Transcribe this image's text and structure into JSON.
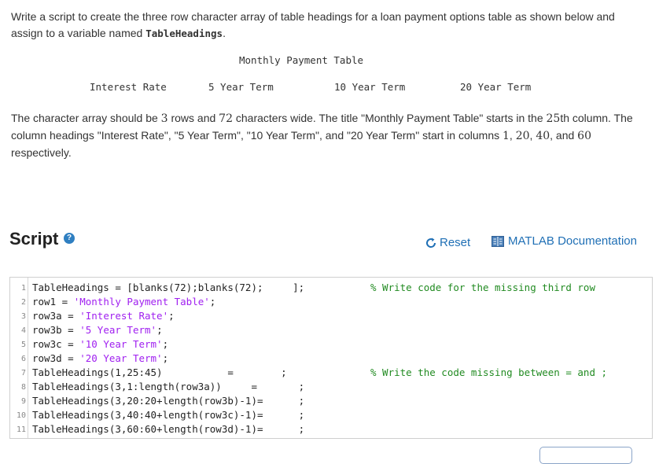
{
  "prompt": {
    "text_before": "Write a script to create the three row character array of table headings for a loan payment options table as shown below and assign to a variable named ",
    "variable_name": "TableHeadings",
    "text_after": "."
  },
  "preview": {
    "title": "Monthly Payment Table",
    "headings": [
      "Interest Rate",
      "5 Year Term",
      "10 Year Term",
      "20 Year Term"
    ]
  },
  "description": {
    "part1": "The character array should be ",
    "rows": "3",
    "part2": " rows and ",
    "cols": "72",
    "part3": " characters wide. The title \"Monthly Payment Table\" starts in the ",
    "col_title": "25",
    "part4": "th column. The column headings \"Interest Rate\", \"5 Year Term\", \"10 Year Term\", and \"20 Year Term\" start in columns ",
    "c1": "1",
    "sep1": ", ",
    "c2": "20",
    "sep2": ", ",
    "c3": "40",
    "sep3": ", and ",
    "c4": "60",
    "part5": " respectively."
  },
  "script": {
    "title": "Script",
    "help_icon": "question-circle-icon",
    "reset_label": "Reset",
    "reset_icon": "reset-arrow-icon",
    "doc_label": "MATLAB Documentation",
    "doc_icon": "documentation-icon"
  },
  "editor": {
    "line_numbers": [
      "1",
      "2",
      "3",
      "4",
      "5",
      "6",
      "7",
      "8",
      "9",
      "10",
      "11"
    ],
    "l1_code": "TableHeadings = [blanks(72);blanks(72);     ];",
    "l1_comment": "% Write code for the missing third row",
    "l2_code": "row1 = ",
    "l2_str": "'Monthly Payment Table'",
    "l2_end": ";",
    "l3_code": "row3a = ",
    "l3_str": "'Interest Rate'",
    "l3_end": ";",
    "l4_code": "row3b = ",
    "l4_str": "'5 Year Term'",
    "l4_end": ";",
    "l5_code": "row3c = ",
    "l5_str": "'10 Year Term'",
    "l5_end": ";",
    "l6_code": "row3d = ",
    "l6_str": "'20 Year Term'",
    "l6_end": ";",
    "l7_code": "TableHeadings(1,25:45)           =        ;",
    "l7_comment": "% Write the code missing between = and ;",
    "l8_code": "TableHeadings(3,1:length(row3a))     =       ;",
    "l9_code": "TableHeadings(3,20:20+length(row3b)-1)=      ;",
    "l10_code": "TableHeadings(3,40:40+length(row3c)-1)=      ;",
    "l11_code": "TableHeadings(3,60:60+length(row3d)-1)=      ;"
  },
  "colors": {
    "link": "#1f6fb5",
    "string": "#a020f0",
    "comment": "#228b22"
  }
}
